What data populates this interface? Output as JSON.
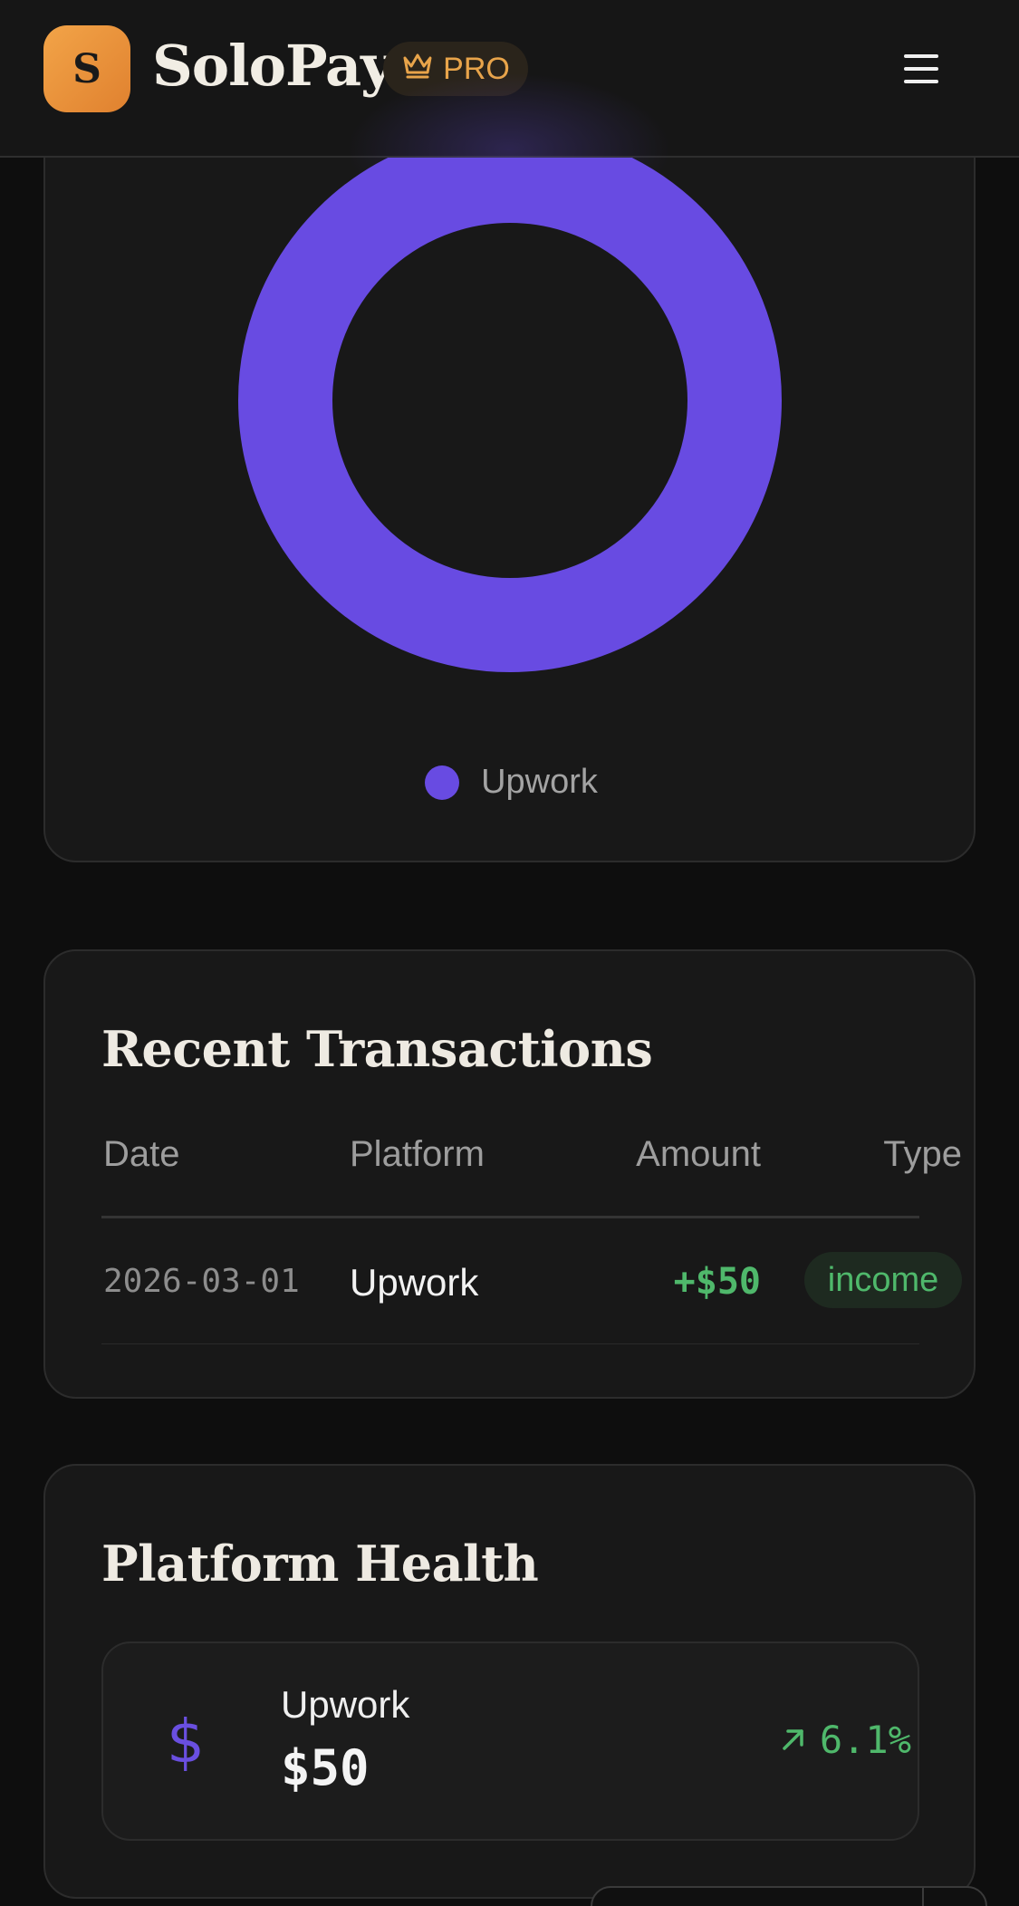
{
  "header": {
    "logo_letter": "S",
    "app_name": "SoloPay",
    "plan_badge": "PRO",
    "icons": {
      "plan": "crown-icon",
      "menu": "hamburger-menu-icon"
    }
  },
  "platform_chart": {
    "chart_data": {
      "type": "pie",
      "style": "donut",
      "categories": [
        "Upwork"
      ],
      "values": [
        50
      ],
      "colors": [
        "#684be2"
      ],
      "legend": "bottom"
    },
    "legend": [
      {
        "label": "Upwork",
        "color": "#684be2"
      }
    ]
  },
  "transactions": {
    "title": "Recent Transactions",
    "columns": {
      "date": "Date",
      "platform": "Platform",
      "amount": "Amount",
      "type": "Type"
    },
    "rows": [
      {
        "date": "2026-03-01",
        "platform": "Upwork",
        "amount": "+$50",
        "type": "income"
      }
    ]
  },
  "health": {
    "title": "Platform Health",
    "items": [
      {
        "platform": "Upwork",
        "amount": "$50",
        "change": "6.1%",
        "icon": "dollar-icon",
        "trend_icon": "arrow-up-right-icon"
      }
    ]
  },
  "colors": {
    "accent": "#684be2",
    "brand": "#e8953a",
    "positive": "#4fb86b",
    "background": "#0e0e0e",
    "card": "#181818"
  }
}
